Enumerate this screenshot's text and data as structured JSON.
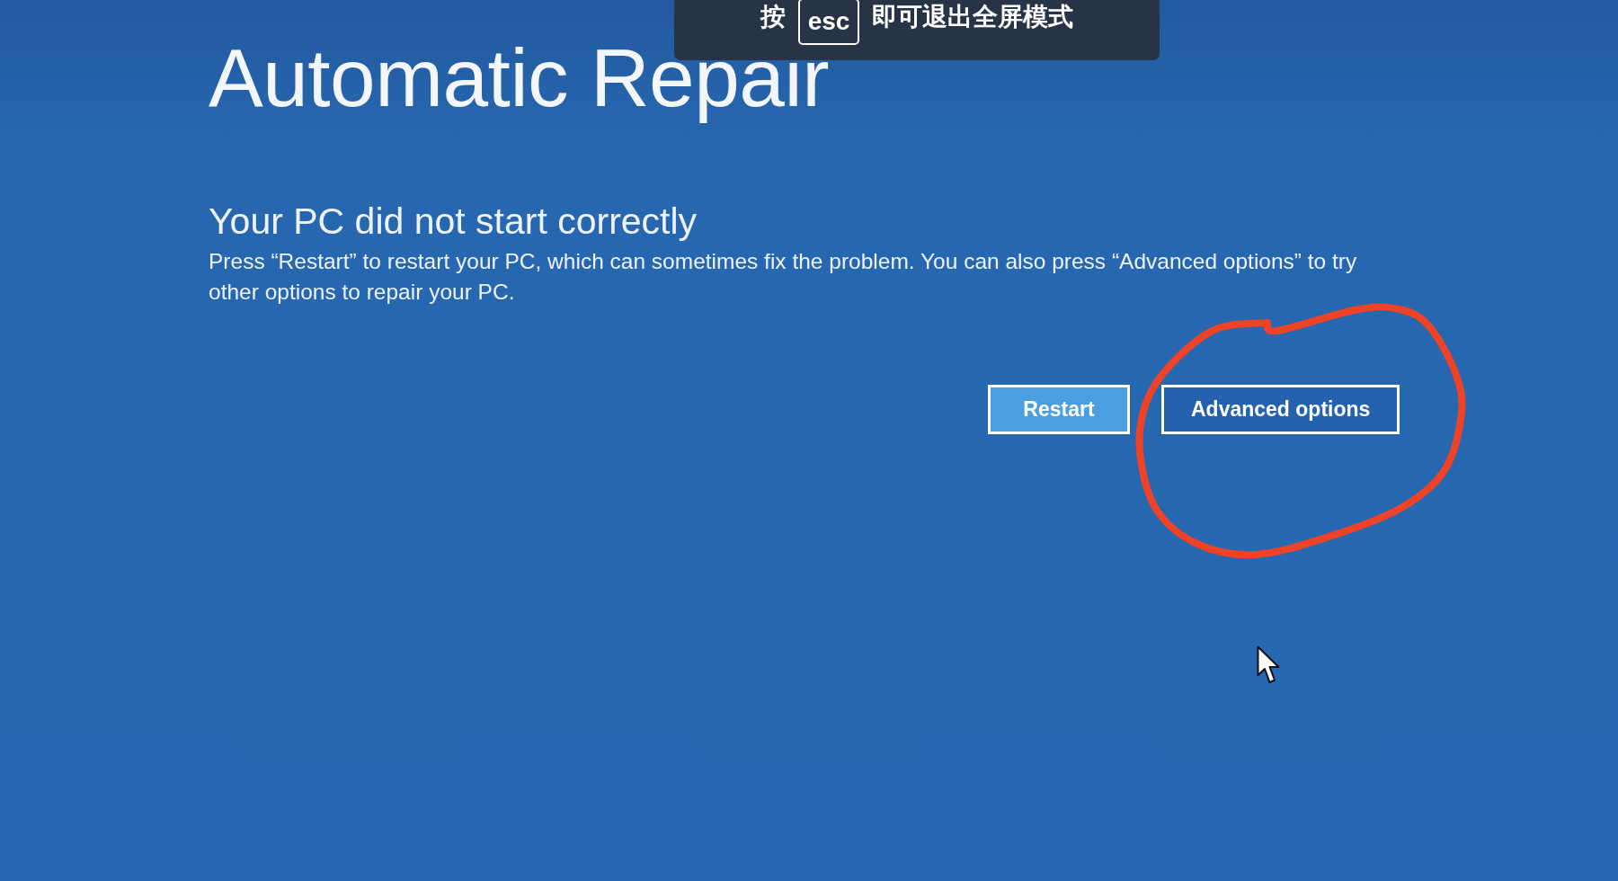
{
  "overlay": {
    "prefix": "按",
    "key": "esc",
    "suffix": "即可退出全屏模式"
  },
  "screen": {
    "title": "Automatic Repair",
    "heading": "Your PC did not start correctly",
    "message": "Press “Restart” to restart your PC, which can sometimes fix the problem. You can also press “Advanced options” to try other options to repair your PC.",
    "buttons": [
      {
        "label": "Restart",
        "focused": true
      },
      {
        "label": "Advanced options",
        "focused": false
      }
    ]
  }
}
